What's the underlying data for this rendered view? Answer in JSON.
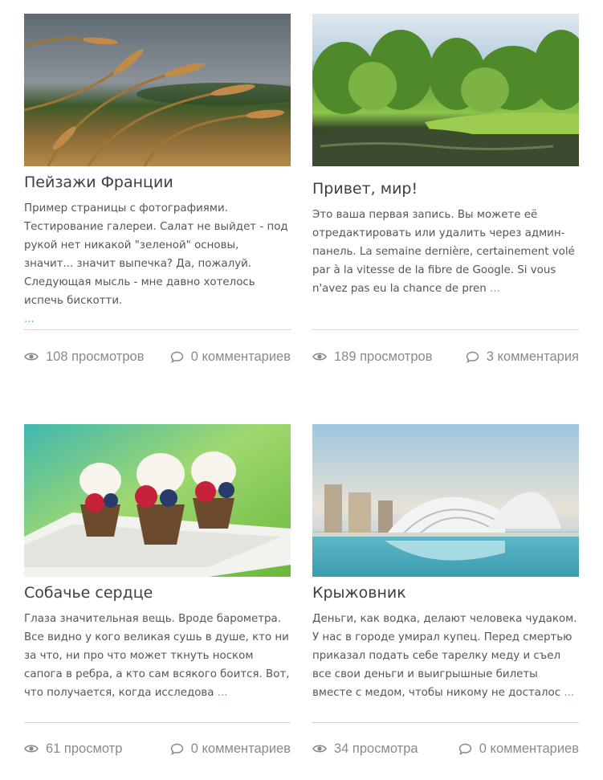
{
  "posts": [
    {
      "title": "Пейзажи Франции",
      "excerpt": "Пример страницы с фотографиями. Тестирование галереи. Салат не выйдет - под рукой нет никакой \"зеленой\" основы, значит... значит выпечка? Да, пожалуй. Следующая мысль - мне давно хотелось испечь бискотти.",
      "more": "...",
      "views": "108 просмотров",
      "comments": "0 комментариев",
      "image": "wheat-field-photo"
    },
    {
      "title": "Привет, мир!",
      "excerpt": "Это ваша первая запись. Вы можете её отредактировать или удалить через админ-панель. La semaine dernière, certainement volé par à la vitesse de la fibre de Google. Si vous n'avez pas eu la chance de pren",
      "more": "...",
      "views": "189 просмотров",
      "comments": "3 комментария",
      "image": "forest-river-photo"
    },
    {
      "title": "Собачье сердце",
      "excerpt": "Глаза значительная вещь. Вроде барометра. Все видно у кого великая сушь в душе, кто ни за что, ни про что может ткнуть носком сапога в ребра, а кто сам всякого боится. Вот, что получается, когда исследова",
      "more": "...",
      "views": "61 просмотр",
      "comments": "0 комментариев",
      "image": "berry-tarts-photo"
    },
    {
      "title": "Крыжовник",
      "excerpt": "Деньги, как водка, делают человека чудаком. У нас в городе умирал купец. Перед смертью приказал подать себе тарелку меду и съел все свои деньги и выигрышные билеты вместе с медом, чтобы никому не досталос",
      "more": "...",
      "views": "34 просмотра",
      "comments": "0 комментариев",
      "image": "modern-architecture-photo"
    }
  ],
  "colors": {
    "title": "#404040",
    "text": "#555555",
    "meta": "#8a8a8a",
    "link": "#6aa0b6",
    "divider": "#d6d6d6"
  }
}
